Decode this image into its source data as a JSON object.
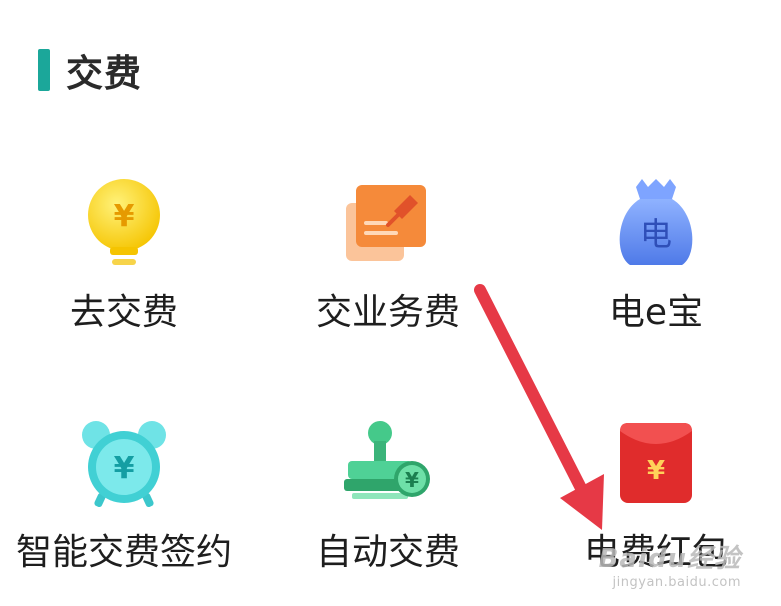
{
  "section": {
    "title": "交费"
  },
  "tiles": [
    {
      "label": "去交费",
      "icon": "yuan-lightbulb-icon"
    },
    {
      "label": "交业务费",
      "icon": "paper-pin-icon"
    },
    {
      "label": "电e宝",
      "icon": "money-bag-icon",
      "glyph": "电"
    },
    {
      "label": "智能交费签约",
      "icon": "yuan-alarm-clock-icon"
    },
    {
      "label": "自动交费",
      "icon": "stamp-yuan-icon"
    },
    {
      "label": "电费红包",
      "icon": "red-envelope-icon"
    }
  ],
  "watermark": {
    "brand": "Baidu经验",
    "url": "jingyan.baidu.com"
  },
  "colors": {
    "accent": "#1ba79a",
    "arrow": "#e63946"
  }
}
